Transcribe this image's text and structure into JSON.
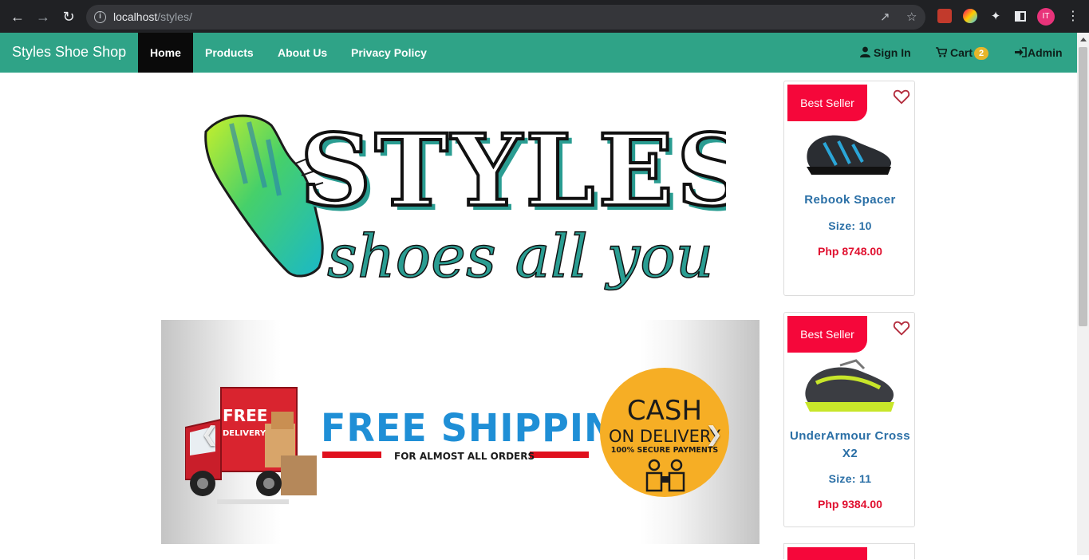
{
  "browser": {
    "url_host": "localhost",
    "url_path": "/styles/",
    "profile_initials": "IT"
  },
  "navbar": {
    "brand": "Styles Shoe Shop",
    "links": [
      "Home",
      "Products",
      "About Us",
      "Privacy Policy"
    ],
    "active": "Home",
    "sign_in": "Sign In",
    "cart": "Cart",
    "cart_count": "2",
    "admin": "Admin",
    "colors": {
      "bar": "#2fa387",
      "active": "#0a0a0a",
      "badge": "#e6b62a"
    }
  },
  "hero": {
    "logo_title": "STYLES",
    "logo_tagline": "shoes all you can"
  },
  "carousel": {
    "truck_label_1": "FREE",
    "truck_label_2": "DELIVERY",
    "headline": "FREE SHIPPING",
    "subline": "FOR ALMOST ALL ORDERS",
    "badge_line1": "CASH",
    "badge_line2": "ON DELIVERY",
    "badge_line3": "100% SECURE PAYMENTS",
    "prev_icon": "chevron-left-icon",
    "next_icon": "chevron-right-icon"
  },
  "products": [
    {
      "badge": "Best Seller",
      "name": "Rebook Spacer",
      "size": "Size: 10",
      "price": "Php 8748.00"
    },
    {
      "badge": "Best Seller",
      "name": "UnderArmour Cross X2",
      "size": "Size: 11",
      "price": "Php 9384.00"
    }
  ]
}
